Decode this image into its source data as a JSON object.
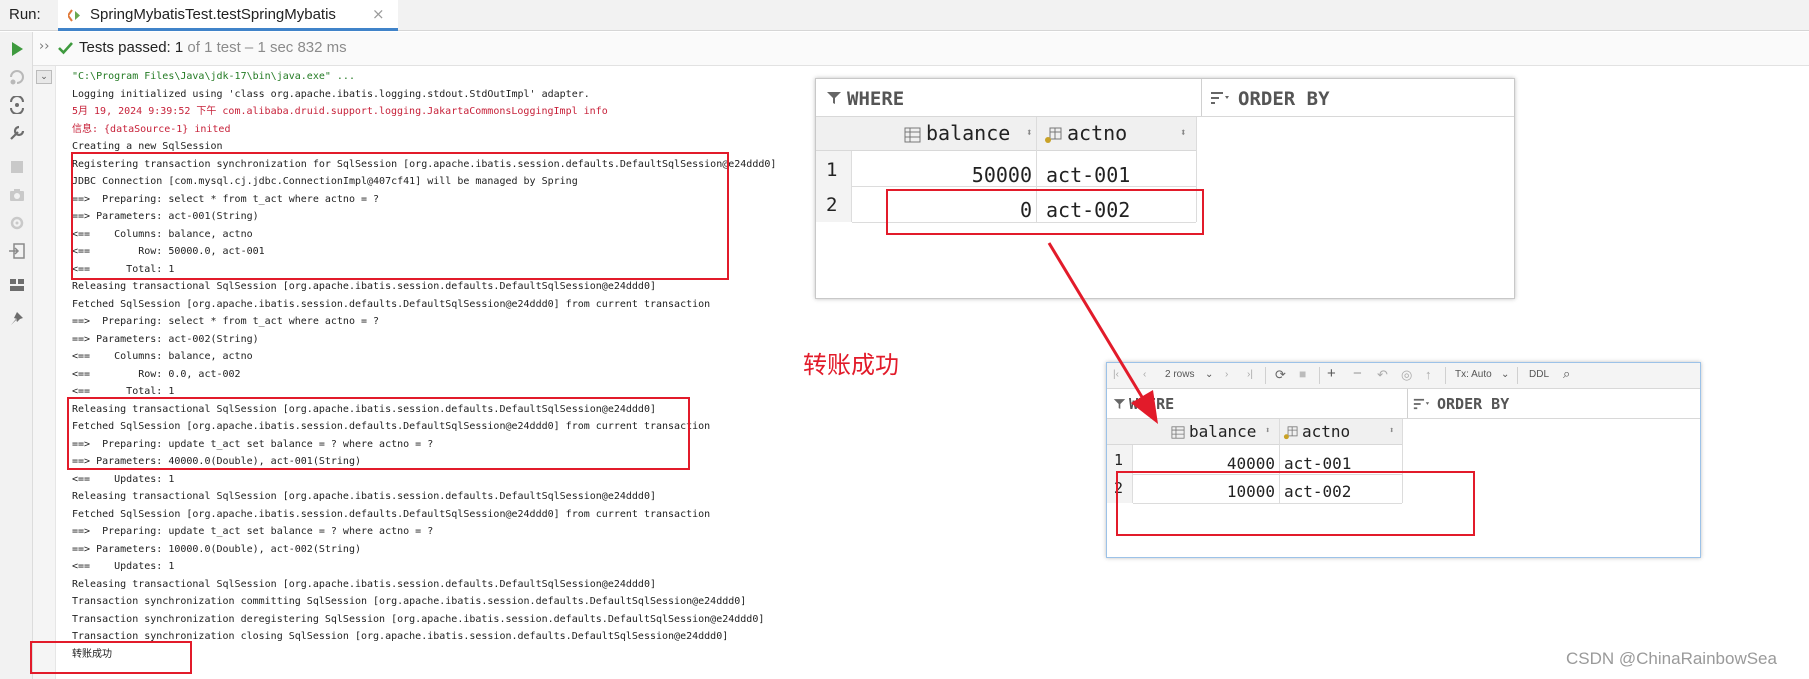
{
  "run": {
    "label": "Run:",
    "tab_title": "SpringMybatisTest.testSpringMybatis",
    "tab_close": "×"
  },
  "status": {
    "arrows": "››",
    "main": "Tests passed: 1",
    "sub": " of 1 test – 1 sec 832 ms"
  },
  "console_lines": [
    {
      "text": "\"C:\\Program Files\\Java\\jdk-17\\bin\\java.exe\" ...",
      "style": "cmd"
    },
    {
      "text": "Logging initialized using 'class org.apache.ibatis.logging.stdout.StdOutImpl' adapter.",
      "style": ""
    },
    {
      "text": "5月 19, 2024 9:39:52 下午 com.alibaba.druid.support.logging.JakartaCommonsLoggingImpl info",
      "style": "red"
    },
    {
      "text": "信息: {dataSource-1} inited",
      "style": "red"
    },
    {
      "text": "Creating a new SqlSession",
      "style": ""
    },
    {
      "text": "Registering transaction synchronization for SqlSession [org.apache.ibatis.session.defaults.DefaultSqlSession@e24ddd0]",
      "style": ""
    },
    {
      "text": "JDBC Connection [com.mysql.cj.jdbc.ConnectionImpl@407cf41] will be managed by Spring",
      "style": ""
    },
    {
      "text": "==>  Preparing: select * from t_act where actno = ?",
      "style": ""
    },
    {
      "text": "==> Parameters: act-001(String)",
      "style": ""
    },
    {
      "text": "<==    Columns: balance, actno",
      "style": ""
    },
    {
      "text": "<==        Row: 50000.0, act-001",
      "style": ""
    },
    {
      "text": "<==      Total: 1",
      "style": ""
    },
    {
      "text": "Releasing transactional SqlSession [org.apache.ibatis.session.defaults.DefaultSqlSession@e24ddd0]",
      "style": ""
    },
    {
      "text": "Fetched SqlSession [org.apache.ibatis.session.defaults.DefaultSqlSession@e24ddd0] from current transaction",
      "style": ""
    },
    {
      "text": "==>  Preparing: select * from t_act where actno = ?",
      "style": ""
    },
    {
      "text": "==> Parameters: act-002(String)",
      "style": ""
    },
    {
      "text": "<==    Columns: balance, actno",
      "style": ""
    },
    {
      "text": "<==        Row: 0.0, act-002",
      "style": ""
    },
    {
      "text": "<==      Total: 1",
      "style": ""
    },
    {
      "text": "Releasing transactional SqlSession [org.apache.ibatis.session.defaults.DefaultSqlSession@e24ddd0]",
      "style": ""
    },
    {
      "text": "Fetched SqlSession [org.apache.ibatis.session.defaults.DefaultSqlSession@e24ddd0] from current transaction",
      "style": ""
    },
    {
      "text": "==>  Preparing: update t_act set balance = ? where actno = ?",
      "style": ""
    },
    {
      "text": "==> Parameters: 40000.0(Double), act-001(String)",
      "style": ""
    },
    {
      "text": "<==    Updates: 1",
      "style": ""
    },
    {
      "text": "Releasing transactional SqlSession [org.apache.ibatis.session.defaults.DefaultSqlSession@e24ddd0]",
      "style": ""
    },
    {
      "text": "Fetched SqlSession [org.apache.ibatis.session.defaults.DefaultSqlSession@e24ddd0] from current transaction",
      "style": ""
    },
    {
      "text": "==>  Preparing: update t_act set balance = ? where actno = ?",
      "style": ""
    },
    {
      "text": "==> Parameters: 10000.0(Double), act-002(String)",
      "style": ""
    },
    {
      "text": "<==    Updates: 1",
      "style": ""
    },
    {
      "text": "Releasing transactional SqlSession [org.apache.ibatis.session.defaults.DefaultSqlSession@e24ddd0]",
      "style": ""
    },
    {
      "text": "Transaction synchronization committing SqlSession [org.apache.ibatis.session.defaults.DefaultSqlSession@e24ddd0]",
      "style": ""
    },
    {
      "text": "Transaction synchronization deregistering SqlSession [org.apache.ibatis.session.defaults.DefaultSqlSession@e24ddd0]",
      "style": ""
    },
    {
      "text": "Transaction synchronization closing SqlSession [org.apache.ibatis.session.defaults.DefaultSqlSession@e24ddd0]",
      "style": ""
    },
    {
      "text": "转账成功",
      "style": ""
    }
  ],
  "table_before": {
    "where_label": "WHERE",
    "order_label": "ORDER BY",
    "columns": [
      "balance",
      "actno"
    ],
    "rows": [
      {
        "num": "1",
        "balance": "50000",
        "actno": "act-001"
      },
      {
        "num": "2",
        "balance": "0",
        "actno": "act-002"
      }
    ]
  },
  "table_after": {
    "toolbar": {
      "rows": "2 rows",
      "tx": "Tx: Auto",
      "ddl": "DDL"
    },
    "where_label": "WHERE",
    "order_label": "ORDER BY",
    "columns": [
      "balance",
      "actno"
    ],
    "rows": [
      {
        "num": "1",
        "balance": "40000",
        "actno": "act-001"
      },
      {
        "num": "2",
        "balance": "10000",
        "actno": "act-002"
      }
    ]
  },
  "annotation": "转账成功",
  "watermark": "CSDN @ChinaRainbowSea",
  "colors": {
    "accent_red": "#e21b2a",
    "tab_underline": "#4083c9",
    "pass_green": "#3e9a3e"
  }
}
